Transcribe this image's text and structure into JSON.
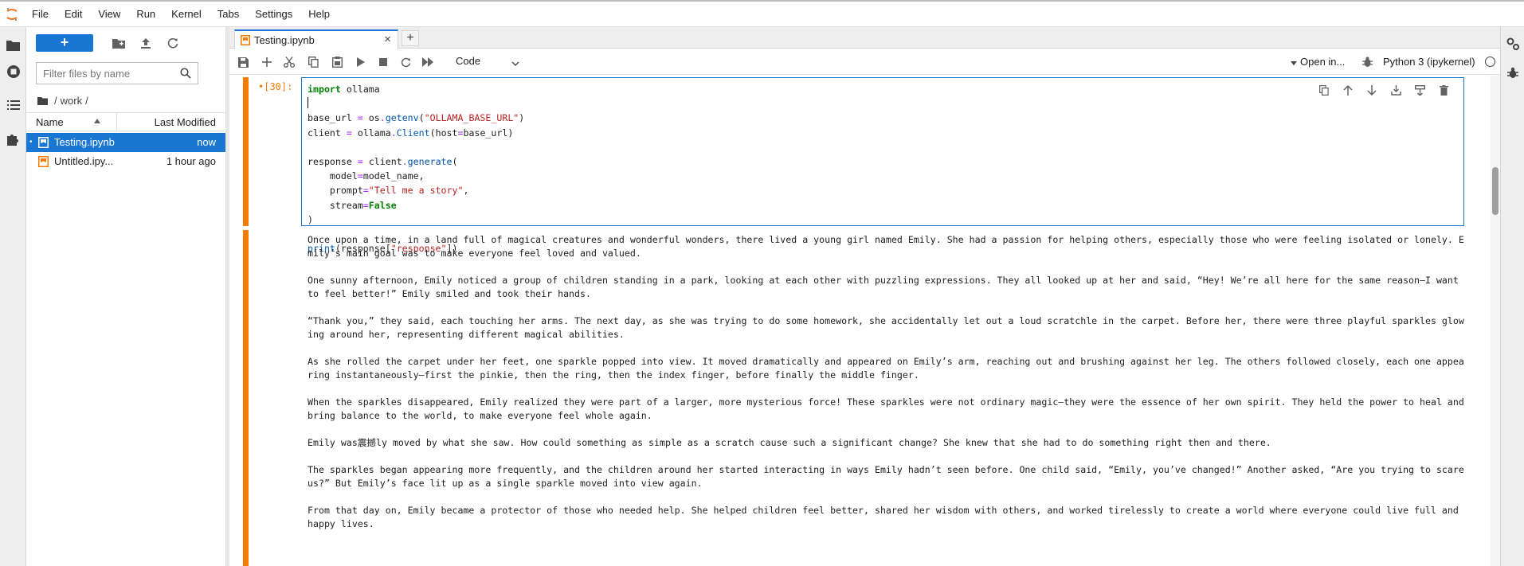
{
  "menu": {
    "items": [
      "File",
      "Edit",
      "View",
      "Run",
      "Kernel",
      "Tabs",
      "Settings",
      "Help"
    ]
  },
  "filebrowser": {
    "new_label": "+",
    "filter_placeholder": "Filter files by name",
    "breadcrumb": {
      "sep1": "/",
      "folder": "work",
      "sep2": "/"
    },
    "columns": {
      "name": "Name",
      "modified": "Last Modified"
    },
    "files": [
      {
        "name": "Testing.ipynb",
        "modified": "now",
        "running": "•"
      },
      {
        "name": "Untitled.ipy...",
        "modified": "1 hour ago",
        "running": ""
      }
    ]
  },
  "tabs": {
    "active_label": "Testing.ipynb",
    "close": "×",
    "add": "+"
  },
  "toolbar": {
    "cell_type": "Code",
    "open_in": "Open in...",
    "kernel": "Python 3 (ipykernel)"
  },
  "cell": {
    "prompt": "•[30]:",
    "code_lines": [
      "import ollama",
      "",
      "base_url = os.getenv(\"OLLAMA_BASE_URL\")",
      "client = ollama.Client(host=base_url)",
      "",
      "response = client.generate(",
      "    model=model_name,",
      "    prompt=\"Tell me a story\",",
      "    stream=False",
      ")",
      "",
      "print(response[\"response\"])"
    ]
  },
  "output": {
    "paragraphs": [
      "Once upon a time, in a land full of magical creatures and wonderful wonders, there lived a young girl named Emily. She had a passion for helping others, especially those who were feeling isolated or lonely. Emily’s main goal was to make everyone feel loved and valued.",
      "One sunny afternoon, Emily noticed a group of children standing in a park, looking at each other with puzzling expressions. They all looked up at her and said, “Hey! We’re all here for the same reason—I want to feel better!” Emily smiled and took their hands.",
      "“Thank you,” they said, each touching her arms. The next day, as she was trying to do some homework, she accidentally let out a loud scratchle in the carpet. Before her, there were three playful sparkles glowing around her, representing different magical abilities.",
      "As she rolled the carpet under her feet, one sparkle popped into view. It moved dramatically and appeared on Emily’s arm, reaching out and brushing against her leg. The others followed closely, each one appearing instantaneously—first the pinkie, then the ring, then the index finger, before finally the middle finger.",
      "When the sparkles disappeared, Emily realized they were part of a larger, more mysterious force! These sparkles were not ordinary magic—they were the essence of her own spirit. They held the power to heal and bring balance to the world, to make everyone feel whole again.",
      "Emily was震撼ly moved by what she saw. How could something as simple as a scratch cause such a significant change? She knew that she had to do something right then and there.",
      "The sparkles began appearing more frequently, and the children around her started interacting in ways Emily hadn’t seen before. One child said, “Emily, you’ve changed!” Another asked, “Are you trying to scare us?” But Emily’s face lit up as a single sparkle moved into view again.",
      "From that day on, Emily became a protector of those who needed help. She helped children feel better, shared her wisdom with others, and worked tirelessly to create a world where everyone could live full and happy lives."
    ]
  },
  "colors": {
    "accent": "#1976d2",
    "cell_active": "#f57c00",
    "notebook_icon": "#f57c00"
  }
}
